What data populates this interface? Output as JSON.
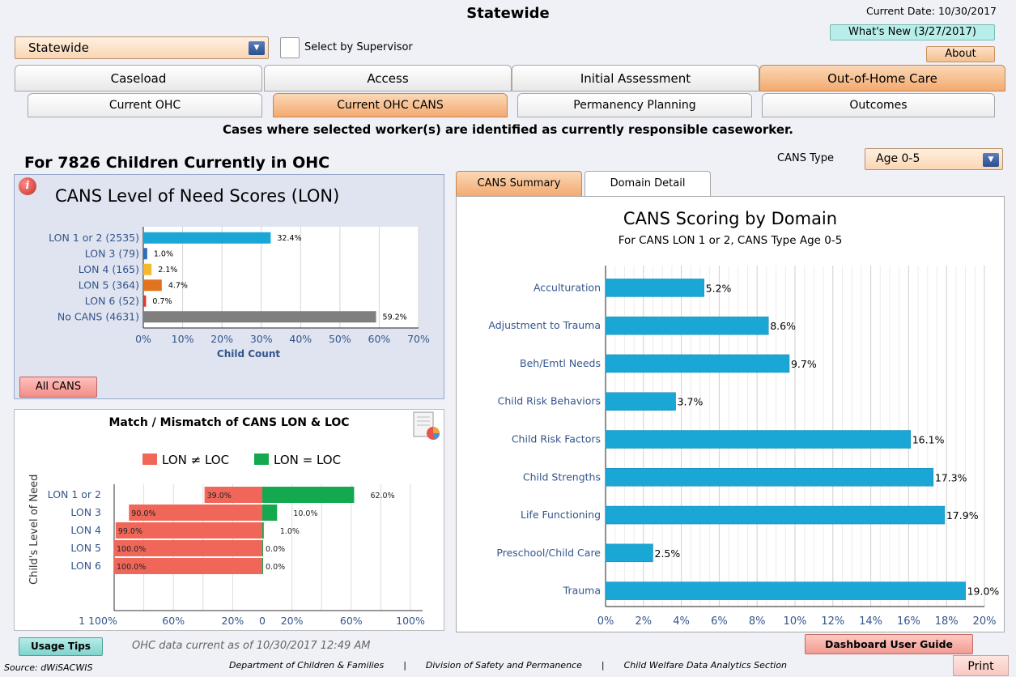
{
  "header": {
    "title": "Statewide",
    "current_date": "Current Date: 10/30/2017",
    "whats_new": "What's New (3/27/2017)",
    "about": "About"
  },
  "filters": {
    "region_select": "Statewide",
    "select_by_supervisor": "Select by Supervisor",
    "cans_type_label": "CANS Type",
    "cans_type_value": "Age 0-5"
  },
  "main_tabs": [
    {
      "label": "Caseload",
      "selected": false
    },
    {
      "label": "Access",
      "selected": false
    },
    {
      "label": "Initial Assessment",
      "selected": false
    },
    {
      "label": "Out-of-Home Care",
      "selected": true
    }
  ],
  "sub_tabs": [
    {
      "label": "Current OHC",
      "selected": false
    },
    {
      "label": "Current OHC CANS",
      "selected": true
    },
    {
      "label": "Permanency Planning",
      "selected": false
    },
    {
      "label": "Outcomes",
      "selected": false
    }
  ],
  "subtitle": "Cases where selected worker(s) are identified as currently responsible caseworker.",
  "children_title": "For 7826 Children Currently in OHC",
  "lon_panel": {
    "info_glyph": "i",
    "title": "CANS Level of Need Scores (LON)",
    "all_cans": "All CANS"
  },
  "match_panel": {
    "title": "Match / Mismatch of CANS LON & LOC",
    "y_axis_title": "Child's Level of Need"
  },
  "domain_tabs": [
    {
      "label": "CANS Summary",
      "selected": true
    },
    {
      "label": "Domain Detail",
      "selected": false
    }
  ],
  "footer": {
    "usage_tips": "Usage Tips",
    "data_current": "OHC data current as of 10/30/2017 12:49 AM",
    "user_guide": "Dashboard User Guide",
    "source": "Source:  dWiSACWIS",
    "dept": "Department of Children & Families",
    "sep": "|",
    "division": "Division of Safety and Permanence",
    "section": "Child Welfare Data Analytics Section",
    "print": "Print"
  },
  "chart_data": [
    {
      "type": "bar",
      "orientation": "horizontal",
      "title": "",
      "categories": [
        "LON 1 or 2 (2535)",
        "LON 3 (79)",
        "LON 4 (165)",
        "LON 5 (364)",
        "LON 6 (52)",
        "No CANS (4631)"
      ],
      "values": [
        32.4,
        1.0,
        2.1,
        4.7,
        0.7,
        59.2
      ],
      "data_labels": [
        "32.4%",
        "1.0%",
        "2.1%",
        "4.7%",
        "0.7%",
        "59.2%"
      ],
      "colors": [
        "#1aa7d6",
        "#2f6fb7",
        "#f4b92c",
        "#e1731f",
        "#e03a2c",
        "#7f7f7f"
      ],
      "xlim": [
        0,
        70
      ],
      "xticks": [
        "0%",
        "10%",
        "20%",
        "30%",
        "40%",
        "50%",
        "60%",
        "70%"
      ],
      "xlabel": "Child Count",
      "grid": true
    },
    {
      "type": "bar",
      "orientation": "horizontal",
      "stacked": "diverging",
      "title": "Match / Mismatch of CANS LON & LOC",
      "categories": [
        "LON 1 or 2",
        "LON 3",
        "LON 4",
        "LON 5",
        "LON 6"
      ],
      "series": [
        {
          "name": "LON ≠ LOC",
          "color": "#f0675a",
          "values": [
            39.0,
            90.0,
            99.0,
            100.0,
            100.0
          ],
          "labels": [
            "39.0%",
            "90.0%",
            "99.0%",
            "100.0%",
            "100.0%"
          ]
        },
        {
          "name": "LON = LOC",
          "color": "#14a94f",
          "values": [
            62.0,
            10.0,
            1.0,
            0.0,
            0.0
          ],
          "labels": [
            "62.0%",
            "10.0%",
            "1.0%",
            "0.0%",
            "0.0%"
          ]
        }
      ],
      "xticks_left": [
        "1 100%",
        "60%",
        "20%"
      ],
      "xticks_right": [
        "0",
        "20%",
        "60%",
        "100%"
      ],
      "ylabel": "Child's Level of Need",
      "legend": "top",
      "grid": true
    },
    {
      "type": "bar",
      "orientation": "horizontal",
      "title": "CANS Scoring by Domain",
      "subtitle": "For CANS LON 1 or 2, CANS Type Age 0-5",
      "categories": [
        "Acculturation",
        "Adjustment to Trauma",
        "Beh/Emtl Needs",
        "Child Risk Behaviors",
        "Child Risk Factors",
        "Child Strengths",
        "Life Functioning",
        "Preschool/Child Care",
        "Trauma"
      ],
      "values": [
        5.2,
        8.6,
        9.7,
        3.7,
        16.1,
        17.3,
        17.9,
        2.5,
        19.0
      ],
      "data_labels": [
        "5.2%",
        "8.6%",
        "9.7%",
        "3.7%",
        "16.1%",
        "17.3%",
        "17.9%",
        "2.5%",
        "19.0%"
      ],
      "color": "#1aa7d6",
      "xlim": [
        0,
        20
      ],
      "xticks": [
        "0%",
        "2%",
        "4%",
        "6%",
        "8%",
        "10%",
        "12%",
        "14%",
        "16%",
        "18%",
        "20%"
      ],
      "grid": true
    }
  ]
}
